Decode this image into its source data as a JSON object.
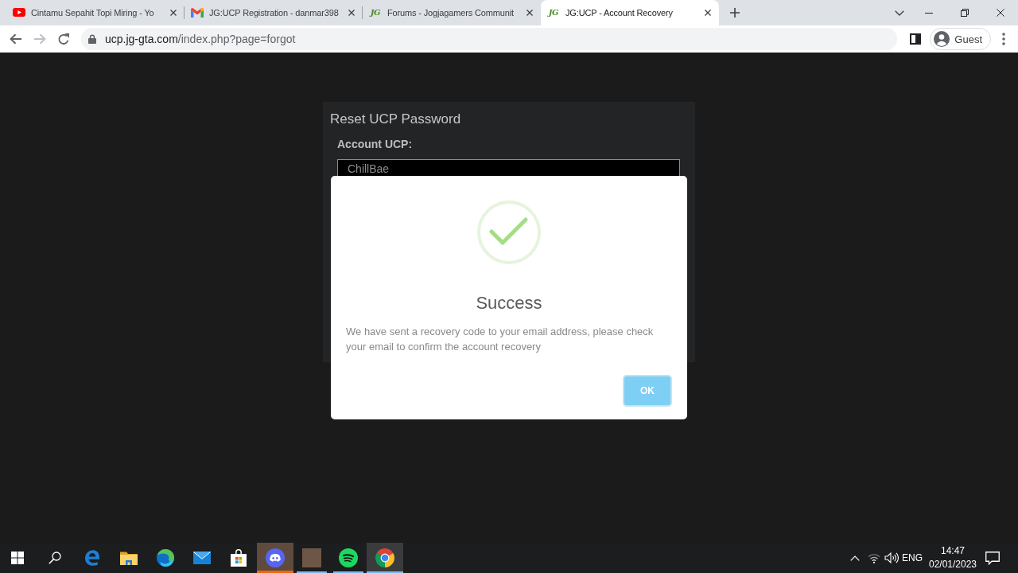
{
  "browser": {
    "tabs": [
      {
        "title": "Cintamu Sepahit Topi Miring - Yo",
        "selected": false
      },
      {
        "title": "JG:UCP Registration - danmar398",
        "selected": false
      },
      {
        "logo": "JG",
        "title": "Forums - Jogjagamers Communit",
        "selected": false
      },
      {
        "logo": "JG",
        "title": "JG:UCP - Account Recovery",
        "selected": true
      }
    ],
    "nav": {
      "back_disabled": false,
      "forward_disabled": true
    },
    "address_bar": {
      "host": "ucp.jg-gta.com",
      "path": "/index.php?page=forgot"
    },
    "profile": {
      "label": "Guest"
    }
  },
  "page": {
    "form": {
      "title": "Reset UCP Password",
      "field_label": "Account UCP:",
      "field_value": "ChillBae"
    },
    "dialog": {
      "title": "Success",
      "message": "We have sent a recovery code to your email address, please check your email to confirm the account recovery",
      "button": "OK"
    }
  },
  "taskbar": {
    "apps": [
      {
        "running": false,
        "flashing": false,
        "selected": false
      },
      {
        "running": false,
        "flashing": false,
        "selected": false
      },
      {
        "running": false,
        "flashing": false,
        "selected": false
      },
      {
        "running": false,
        "flashing": false,
        "selected": false
      },
      {
        "running": false,
        "flashing": false,
        "selected": false
      },
      {
        "running": true,
        "flashing": true,
        "selected": false
      },
      {
        "running": true,
        "flashing": false,
        "selected": false
      },
      {
        "running": true,
        "flashing": false,
        "selected": false
      },
      {
        "running": true,
        "flashing": false,
        "selected": true
      }
    ],
    "tray": {
      "language": "ENG",
      "time": "14:47",
      "date": "02/01/2023"
    }
  }
}
